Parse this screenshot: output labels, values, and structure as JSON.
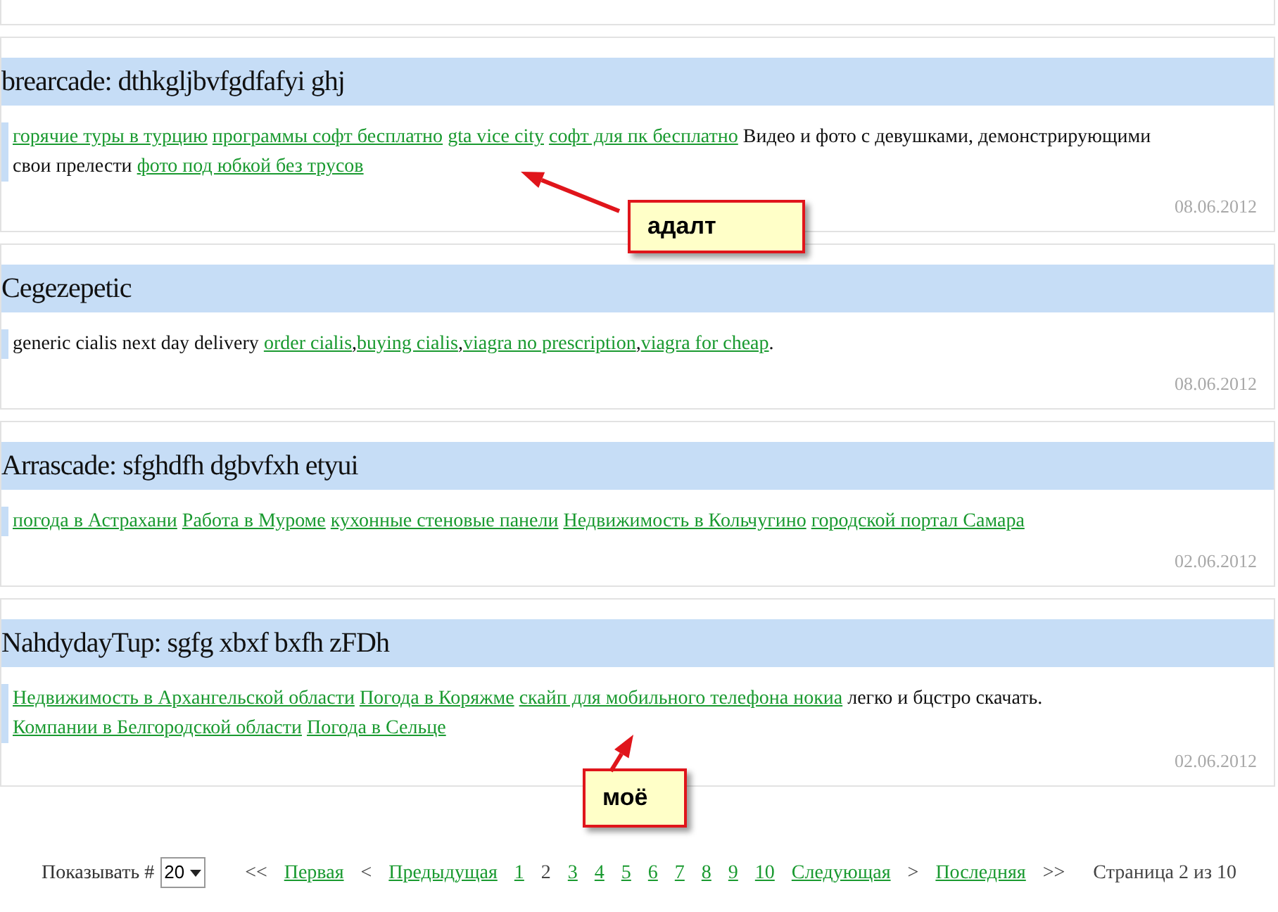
{
  "comments": [
    {
      "title": "brearcade: dthkgljbvfgdfafyi ghj",
      "date": "08.06.2012",
      "body": [
        {
          "kind": "link",
          "text": "горячие туры в турцию"
        },
        {
          "kind": "link",
          "text": "программы софт бесплатно"
        },
        {
          "kind": "link",
          "text": "gta vice city"
        },
        {
          "kind": "link",
          "text": "софт для пк бесплатно"
        },
        {
          "kind": "text",
          "text": " Видео и фото с девушками, демонстрирующими свои прелести "
        },
        {
          "kind": "link",
          "text": "фото под юбкой без трусов"
        }
      ]
    },
    {
      "title": "Cegezepetic",
      "date": "08.06.2012",
      "body": [
        {
          "kind": "text",
          "text": "generic cialis next day delivery "
        },
        {
          "kind": "link",
          "text": "order cialis"
        },
        {
          "kind": "text",
          "text": ","
        },
        {
          "kind": "link",
          "text": "buying cialis"
        },
        {
          "kind": "text",
          "text": ","
        },
        {
          "kind": "link",
          "text": "viagra no prescription"
        },
        {
          "kind": "text",
          "text": ","
        },
        {
          "kind": "link",
          "text": "viagra for cheap"
        },
        {
          "kind": "text",
          "text": "."
        }
      ]
    },
    {
      "title": "Arrascade: sfghdfh dgbvfxh etyui",
      "date": "02.06.2012",
      "body": [
        {
          "kind": "link",
          "text": "погода в Астрахани"
        },
        {
          "kind": "link",
          "text": "Работа в Муроме"
        },
        {
          "kind": "link",
          "text": "кухонные стеновые панели"
        },
        {
          "kind": "link",
          "text": "Недвижимость в Кольчугино"
        },
        {
          "kind": "link",
          "text": "городской портал Самара"
        }
      ]
    },
    {
      "title": "NahdydayTup: sgfg xbxf bxfh zFDh",
      "date": "02.06.2012",
      "body": [
        {
          "kind": "link",
          "text": "Недвижимость в Архангельской области"
        },
        {
          "kind": "link",
          "text": "Погода в Коряжме"
        },
        {
          "kind": "link",
          "text": "скайп для мобильного телефона нокиа"
        },
        {
          "kind": "text",
          "text": " легко и бцстро скачать. "
        },
        {
          "kind": "link",
          "text": "Компании в Белгородской области"
        },
        {
          "kind": "link",
          "text": "Погода в Сельце"
        }
      ]
    }
  ],
  "callouts": [
    {
      "text": "адалт"
    },
    {
      "text": "моё"
    }
  ],
  "pagination": {
    "show_label": "Показывать #",
    "per_page": "20",
    "items": [
      {
        "kind": "sep",
        "text": "<<"
      },
      {
        "kind": "link",
        "text": "Первая"
      },
      {
        "kind": "sep",
        "text": "<"
      },
      {
        "kind": "link",
        "text": "Предыдущая"
      },
      {
        "kind": "link",
        "text": "1"
      },
      {
        "kind": "current",
        "text": "2"
      },
      {
        "kind": "link",
        "text": "3"
      },
      {
        "kind": "link",
        "text": "4"
      },
      {
        "kind": "link",
        "text": "5"
      },
      {
        "kind": "link",
        "text": "6"
      },
      {
        "kind": "link",
        "text": "7"
      },
      {
        "kind": "link",
        "text": "8"
      },
      {
        "kind": "link",
        "text": "9"
      },
      {
        "kind": "link",
        "text": "10"
      },
      {
        "kind": "link",
        "text": "Следующая"
      },
      {
        "kind": "sep",
        "text": ">"
      },
      {
        "kind": "link",
        "text": "Последняя"
      },
      {
        "kind": "sep",
        "text": ">>"
      }
    ],
    "page_info": "Страница 2 из 10"
  }
}
